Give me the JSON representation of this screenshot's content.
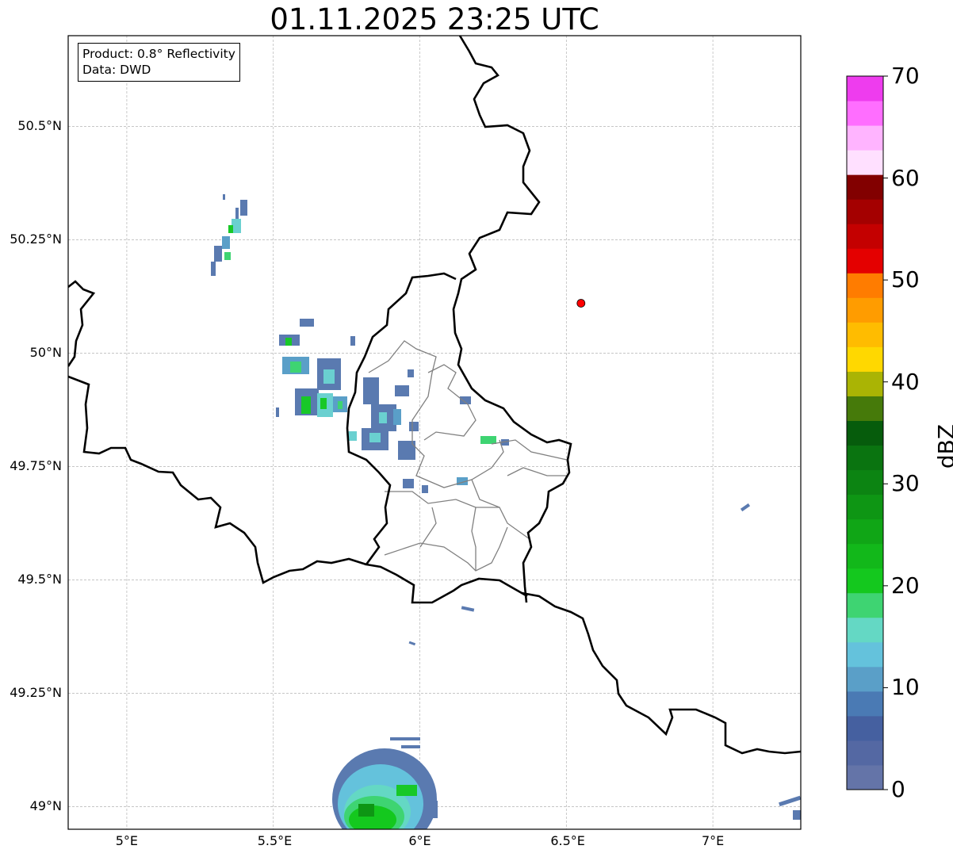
{
  "title": "01.11.2025 23:25 UTC",
  "info_box": {
    "product": "Product: 0.8° Reflectivity",
    "source": "Data: DWD"
  },
  "lat_labels": [
    "50.5°N",
    "50.25°N",
    "50°N",
    "49.75°N",
    "49.5°N",
    "49.25°N",
    "49°N"
  ],
  "lat_values": [
    50.5,
    50.25,
    50.0,
    49.75,
    49.5,
    49.25,
    49.0
  ],
  "lon_labels": [
    "5°E",
    "5.5°E",
    "6°E",
    "6.5°E",
    "7°E"
  ],
  "lon_values": [
    5.0,
    5.5,
    6.0,
    6.5,
    7.0
  ],
  "extent": {
    "lon_min": 4.8,
    "lon_max": 7.3,
    "lat_min": 48.95,
    "lat_max": 50.7
  },
  "marker": {
    "lon": 6.55,
    "lat": 50.11,
    "color": "#ff0000"
  },
  "colorbar": {
    "label": "dBZ",
    "min": 0,
    "max": 70,
    "tick_labels": [
      "0",
      "10",
      "20",
      "30",
      "40",
      "50",
      "60",
      "70"
    ],
    "colors": [
      "#6474a8",
      "#5468a3",
      "#4560a0",
      "#4a7ab4",
      "#5a9fc8",
      "#64c2dc",
      "#64d8c4",
      "#3ed472",
      "#14c81e",
      "#12b81a",
      "#10a616",
      "#0e9614",
      "#0c8412",
      "#0a7410",
      "#065c0c",
      "#467a0a",
      "#aab404",
      "#ffd800",
      "#ffbc00",
      "#ff9c00",
      "#ff7c00",
      "#e40000",
      "#c40000",
      "#a40000",
      "#820000",
      "#ffe0ff",
      "#ffb4ff",
      "#ff6eff",
      "#ee3cee"
    ]
  },
  "echo_colors": {
    "light": "#5a7ab0",
    "cyan": "#6ad0d0",
    "green": "#18c828"
  }
}
